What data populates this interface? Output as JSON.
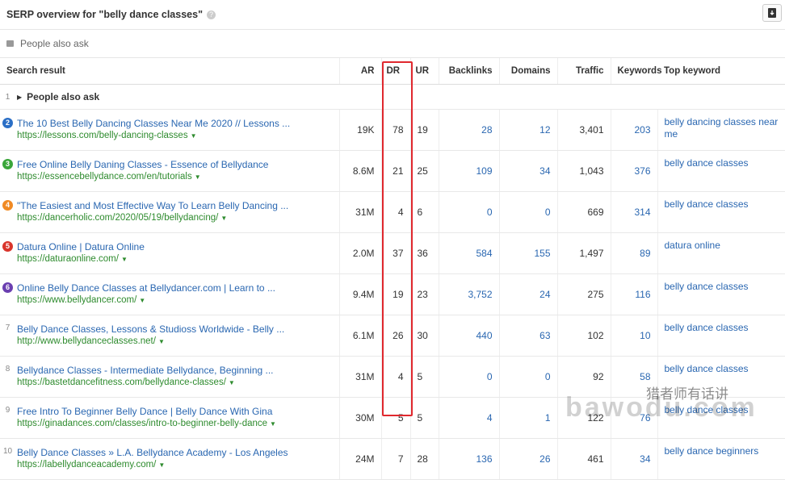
{
  "header": {
    "title": "SERP overview for \"belly dance classes\"",
    "help": "?",
    "export_icon": "download-icon"
  },
  "people_also_ask_bar": "People also ask",
  "columns": [
    "Search result",
    "AR",
    "DR",
    "UR",
    "Backlinks",
    "Domains",
    "Traffic",
    "Keywords",
    "Top keyword"
  ],
  "paa_row": {
    "index": "1",
    "label": "People also ask"
  },
  "rows": [
    {
      "n": "2",
      "color": "#2b6fc6",
      "title": "The 10 Best Belly Dancing Classes Near Me 2020 // Lessons ...",
      "url": "https://lessons.com/belly-dancing-classes",
      "ar": "19K",
      "dr": "78",
      "ur": "19",
      "backlinks": "28",
      "domains": "12",
      "traffic": "3,401",
      "keywords": "203",
      "top": "belly dancing classes near me"
    },
    {
      "n": "3",
      "color": "#3aa63a",
      "title": "Free Online Belly Daning Classes - Essence of Bellydance",
      "url": "https://essencebellydance.com/en/tutorials",
      "ar": "8.6M",
      "dr": "21",
      "ur": "25",
      "backlinks": "109",
      "domains": "34",
      "traffic": "1,043",
      "keywords": "376",
      "top": "belly dance classes"
    },
    {
      "n": "4",
      "color": "#f08a24",
      "title": "\"The Easiest and Most Effective Way To Learn Belly Dancing ...",
      "url": "https://dancerholic.com/2020/05/19/bellydancing/",
      "ar": "31M",
      "dr": "4",
      "ur": "6",
      "backlinks": "0",
      "domains": "0",
      "traffic": "669",
      "keywords": "314",
      "top": "belly dance classes"
    },
    {
      "n": "5",
      "color": "#d9342b",
      "title": "Datura Online | Datura Online",
      "url": "https://daturaonline.com/",
      "ar": "2.0M",
      "dr": "37",
      "ur": "36",
      "backlinks": "584",
      "domains": "155",
      "traffic": "1,497",
      "keywords": "89",
      "top": "datura online"
    },
    {
      "n": "6",
      "color": "#6a3fb0",
      "title": "Online Belly Dance Classes at Bellydancer.com | Learn to ...",
      "url": "https://www.bellydancer.com/",
      "ar": "9.4M",
      "dr": "19",
      "ur": "23",
      "backlinks": "3,752",
      "domains": "24",
      "traffic": "275",
      "keywords": "116",
      "top": "belly dance classes"
    },
    {
      "n": "7",
      "color": "",
      "title": "Belly Dance Classes, Lessons & Studioss Worldwide - Belly ...",
      "url": "http://www.bellydanceclasses.net/",
      "ar": "6.1M",
      "dr": "26",
      "ur": "30",
      "backlinks": "440",
      "domains": "63",
      "traffic": "102",
      "keywords": "10",
      "top": "belly dance classes"
    },
    {
      "n": "8",
      "color": "",
      "title": "Bellydance Classes - Intermediate Bellydance, Beginning ...",
      "url": "https://bastetdancefitness.com/bellydance-classes/",
      "ar": "31M",
      "dr": "4",
      "ur": "5",
      "backlinks": "0",
      "domains": "0",
      "traffic": "92",
      "keywords": "58",
      "top": "belly dance classes"
    },
    {
      "n": "9",
      "color": "",
      "title": "Free Intro To Beginner Belly Dance | Belly Dance With Gina",
      "url": "https://ginadances.com/classes/intro-to-beginner-belly-dance",
      "ar": "30M",
      "dr": "5",
      "ur": "5",
      "backlinks": "4",
      "domains": "1",
      "traffic": "122",
      "keywords": "76",
      "top": "belly dance classes"
    },
    {
      "n": "10",
      "color": "",
      "title": "Belly Dance Classes » L.A. Bellydance Academy - Los Angeles",
      "url": "https://labellydanceacademy.com/",
      "ar": "24M",
      "dr": "7",
      "ur": "28",
      "backlinks": "136",
      "domains": "26",
      "traffic": "461",
      "keywords": "34",
      "top": "belly dance beginners"
    }
  ],
  "watermark": {
    "big": "bawodu.com",
    "small": "猎者师有话讲"
  },
  "highlight_color": "#e0282e"
}
